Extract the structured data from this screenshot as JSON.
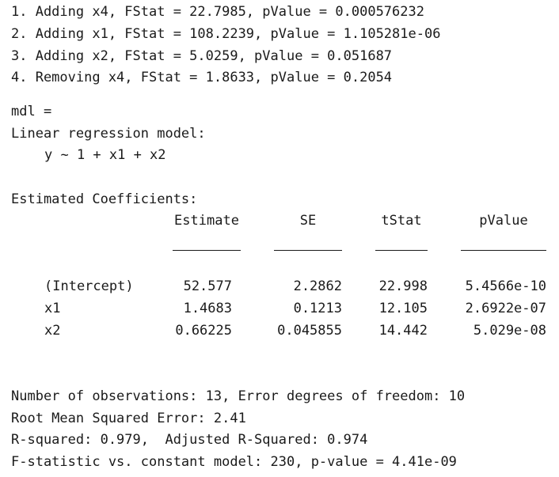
{
  "steps": [
    "1. Adding x4, FStat = 22.7985, pValue = 0.000576232",
    "2. Adding x1, FStat = 108.2239, pValue = 1.105281e-06",
    "3. Adding x2, FStat = 5.0259, pValue = 0.051687",
    "4. Removing x4, FStat = 1.8633, pValue = 0.2054"
  ],
  "model": {
    "var_line": "mdl =",
    "type_line": "Linear regression model:",
    "formula": "y ~ 1 + x1 + x2"
  },
  "coefficients": {
    "heading": "Estimated Coefficients:",
    "columns": [
      "Estimate",
      "SE",
      "tStat",
      "pValue"
    ],
    "rows": [
      {
        "name": "(Intercept)",
        "values": [
          "52.577",
          "2.2862",
          "22.998",
          "5.4566e-10"
        ]
      },
      {
        "name": "x1",
        "values": [
          "1.4683",
          "0.1213",
          "12.105",
          "2.6922e-07"
        ]
      },
      {
        "name": "x2",
        "values": [
          "0.66225",
          "0.045855",
          "14.442",
          "5.029e-08"
        ]
      }
    ]
  },
  "summary": [
    "Number of observations: 13, Error degrees of freedom: 10",
    "Root Mean Squared Error: 2.41",
    "R-squared: 0.979,  Adjusted R-Squared: 0.974",
    "F-statistic vs. constant model: 230, p-value = 4.41e-09"
  ]
}
